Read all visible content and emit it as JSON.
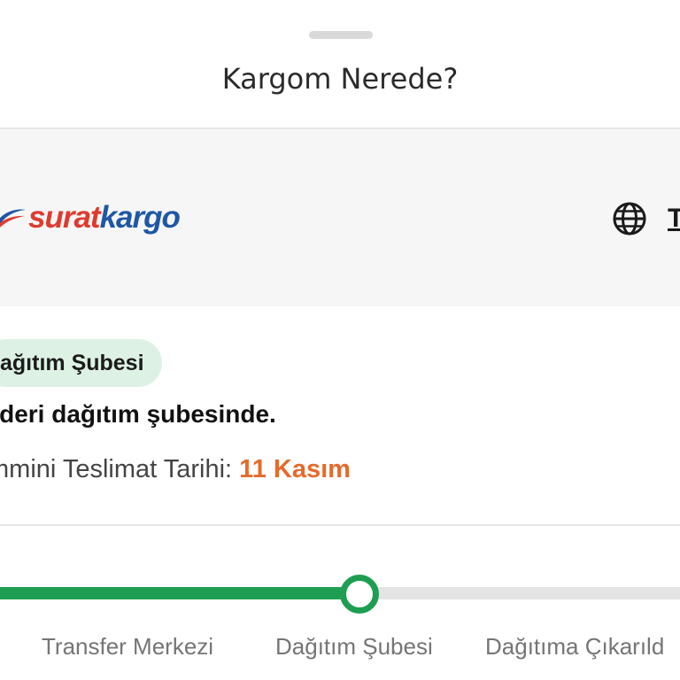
{
  "sheet": {
    "title": "Kargom Nerede?"
  },
  "brand": {
    "logo_text_part1": "surat",
    "logo_text_part2": "kargo",
    "logo_colors": {
      "primary": "#e03a2f",
      "secondary": "#1f57a6"
    },
    "language_icon": "globe-icon",
    "language_label": "T"
  },
  "status": {
    "badge": "ağıtım Şubesi",
    "message": "nderi dağıtım şubesinde.",
    "eta_label": "mmini Teslimat Tarihi:",
    "eta_value": "11 Kasım"
  },
  "progress": {
    "steps": [
      {
        "label": "Transfer Merkezi",
        "state": "done"
      },
      {
        "label": "Dağıtım Şubesi",
        "state": "current"
      },
      {
        "label": "Dağıtıma Çıkarıld",
        "state": "pending"
      }
    ],
    "colors": {
      "done": "#1e9e52",
      "pending": "#e4e4e4"
    }
  },
  "colors": {
    "accent_orange": "#e66a2c",
    "badge_bg": "#ddf1e4"
  }
}
